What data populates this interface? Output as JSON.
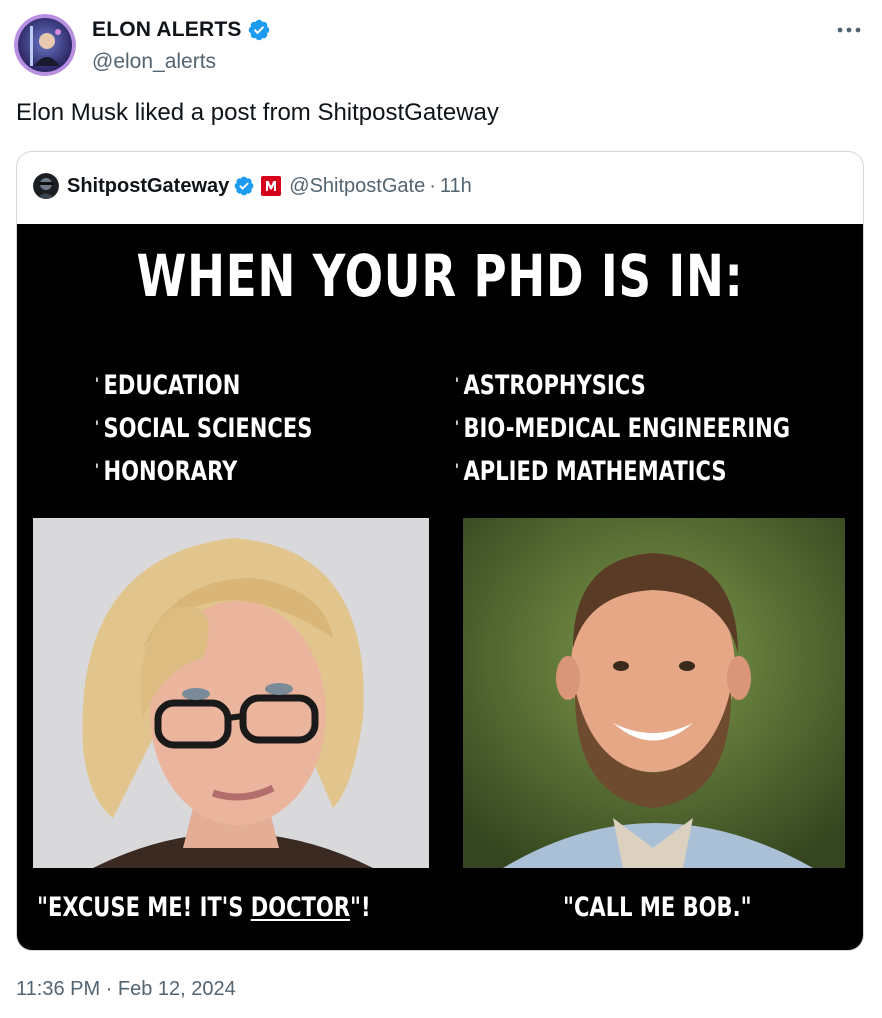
{
  "author": {
    "display_name": "ELON ALERTS",
    "handle": "@elon_alerts",
    "avatar_icon": "avatar-icon",
    "verified_color": "#1d9bf0"
  },
  "post": {
    "text": "Elon Musk liked a post from ShitpostGateway",
    "timestamp": "11:36 PM · Feb 12, 2024"
  },
  "quote": {
    "display_name": "ShitpostGateway",
    "handle": "@ShitpostGate",
    "separator": "·",
    "time": "11h",
    "affiliate_badge": "M",
    "meme": {
      "title": "WHEN YOUR PHD IS IN:",
      "left_list": [
        "EDUCATION",
        "SOCIAL SCIENCES",
        "HONORARY"
      ],
      "right_list": [
        "ASTROPHYSICS",
        "BIO-MEDICAL ENGINEERING",
        "APLIED MATHEMATICS"
      ],
      "left_caption": {
        "before": "\"EXCUSE ME!  IT'S ",
        "underlined": "DOCTOR",
        "after": "\"!"
      },
      "right_caption": "\"CALL ME BOB.\""
    }
  },
  "colors": {
    "text_primary": "#0f1419",
    "text_secondary": "#536471",
    "border": "#cfd9de",
    "brand_red": "#d6001c"
  }
}
